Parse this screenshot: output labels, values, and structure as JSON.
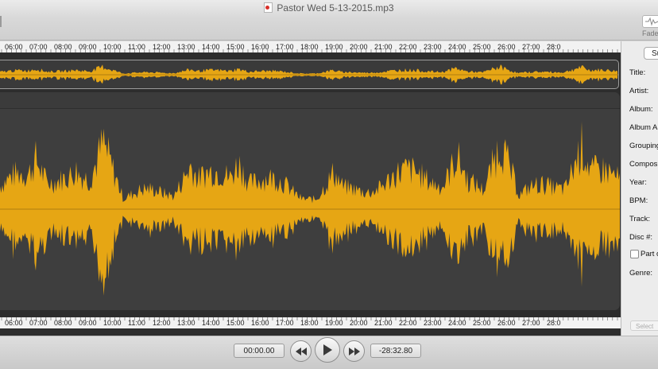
{
  "window": {
    "title": "Pastor Wed 5-13-2015.mp3"
  },
  "toolbar": {
    "fade_label": "Fade"
  },
  "ruler": {
    "labels": [
      "06:00",
      "07:00",
      "08:00",
      "09:00",
      "10:00",
      "11:00",
      "12:00",
      "13:00",
      "14:00",
      "15:00",
      "16:00",
      "17:00",
      "18:00",
      "19:00",
      "20:00",
      "21:00",
      "22:00",
      "23:00",
      "24:00",
      "25:00",
      "26:00",
      "27:00",
      "28:0"
    ]
  },
  "waveform": {
    "color": "#e6a614",
    "background": "#3e3e3e"
  },
  "sidebar": {
    "sub_button": "Su",
    "fields": [
      "Title:",
      "Artist:",
      "Album:",
      "Album A",
      "Grouping",
      "Compos",
      "Year:",
      "BPM:",
      "Track:",
      "Disc #:",
      "Part o",
      "Genre:"
    ],
    "select_label": "Select"
  },
  "transport": {
    "current_time": "00:00.00",
    "remaining_time": "-28:32.80",
    "rewind_icon": "rewind-icon",
    "play_icon": "play-icon",
    "forward_icon": "fast-forward-icon"
  }
}
